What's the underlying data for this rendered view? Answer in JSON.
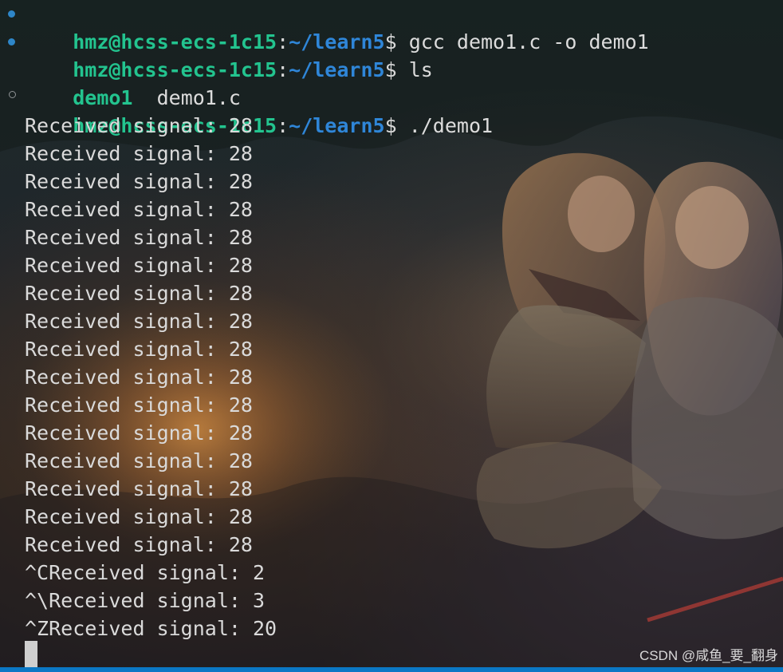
{
  "terminal": {
    "lines": [
      {
        "status": "success",
        "user_host": "hmz@hcss-ecs-1c15",
        "colon": ":",
        "path": "~/learn5",
        "dollar": "$",
        "command": " gcc demo1.c -o demo1"
      },
      {
        "status": "success",
        "user_host": "hmz@hcss-ecs-1c15",
        "colon": ":",
        "path": "~/learn5",
        "dollar": "$",
        "command": " ls"
      },
      {
        "dir": "demo1",
        "file": "  demo1.c"
      },
      {
        "status": "running",
        "user_host": "hmz@hcss-ecs-1c15",
        "colon": ":",
        "path": "~/learn5",
        "dollar": "$",
        "command": " ./demo1"
      }
    ],
    "output": [
      "Received signal: 28",
      "Received signal: 28",
      "Received signal: 28",
      "Received signal: 28",
      "Received signal: 28",
      "Received signal: 28",
      "Received signal: 28",
      "Received signal: 28",
      "Received signal: 28",
      "Received signal: 28",
      "Received signal: 28",
      "Received signal: 28",
      "Received signal: 28",
      "Received signal: 28",
      "Received signal: 28",
      "Received signal: 28",
      "^CReceived signal: 2",
      "^\\Received signal: 3",
      "^ZReceived signal: 20"
    ]
  },
  "watermark": {
    "text": "CSDN @咸鱼_要_翻身"
  },
  "colors": {
    "prompt_user": "#23c48f",
    "prompt_path": "#2f86d8",
    "status_success": "#2e86c8",
    "bottom_bar": "#0b78c5"
  },
  "icons": {
    "success": "filled-dot",
    "running": "hollow-dot"
  }
}
